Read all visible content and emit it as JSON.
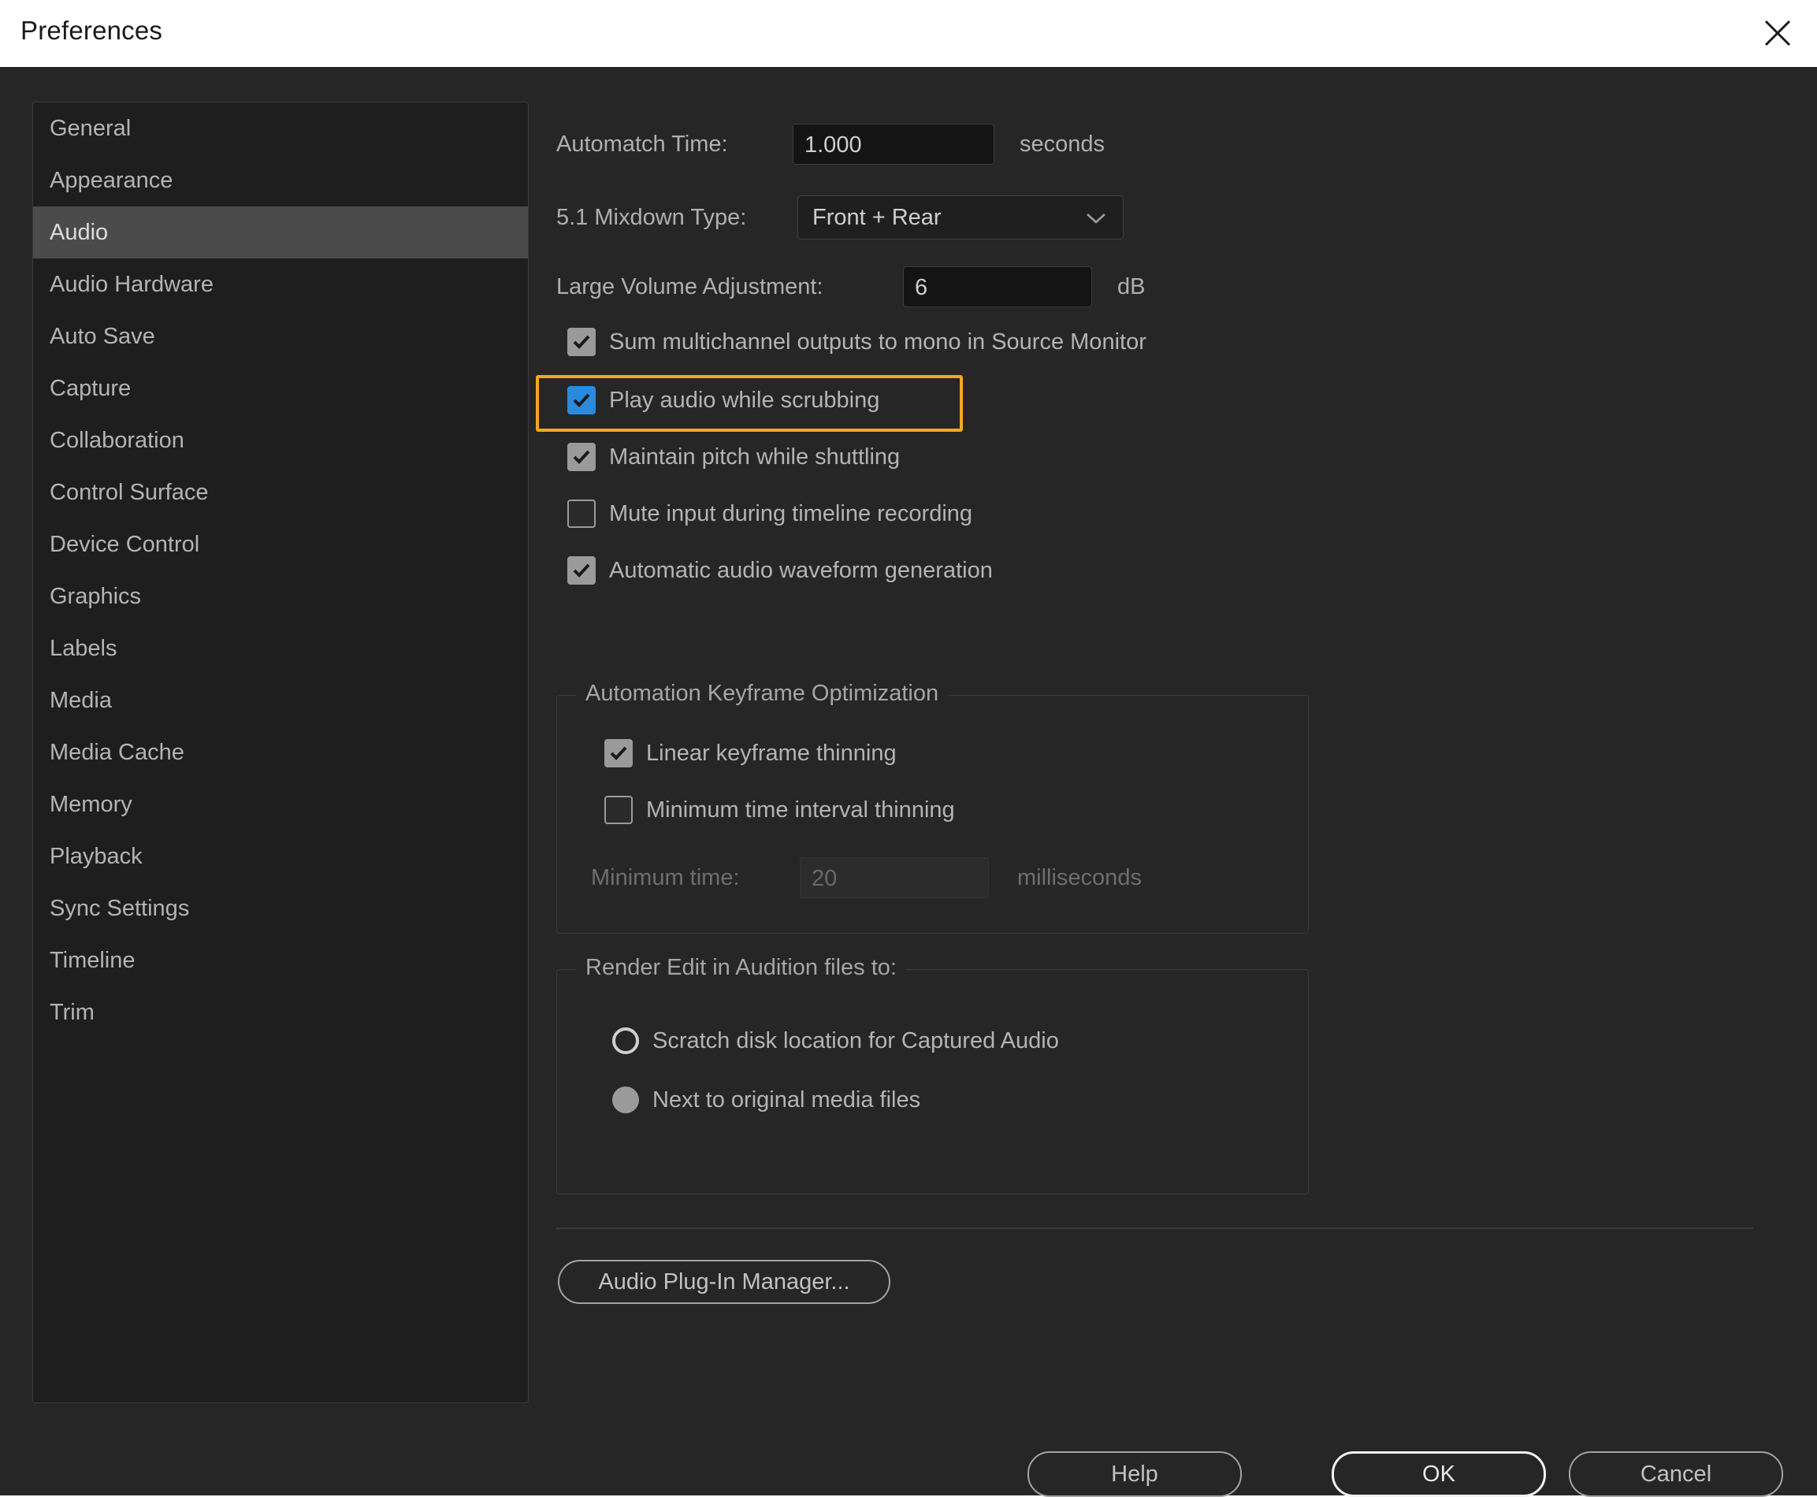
{
  "window": {
    "title": "Preferences",
    "close_icon": "close-icon"
  },
  "colors": {
    "accent_checkbox": "#2a8ae0",
    "focus_highlight": "#f5a623",
    "selected_sidebar": "#4b4b4b",
    "dialog_background": "#262626",
    "sidebar_background": "#1e1e1e",
    "titlebar_background": "#ffffff"
  },
  "sidebar": {
    "items": [
      {
        "label": "General",
        "selected": false
      },
      {
        "label": "Appearance",
        "selected": false
      },
      {
        "label": "Audio",
        "selected": true
      },
      {
        "label": "Audio Hardware",
        "selected": false
      },
      {
        "label": "Auto Save",
        "selected": false
      },
      {
        "label": "Capture",
        "selected": false
      },
      {
        "label": "Collaboration",
        "selected": false
      },
      {
        "label": "Control Surface",
        "selected": false
      },
      {
        "label": "Device Control",
        "selected": false
      },
      {
        "label": "Graphics",
        "selected": false
      },
      {
        "label": "Labels",
        "selected": false
      },
      {
        "label": "Media",
        "selected": false
      },
      {
        "label": "Media Cache",
        "selected": false
      },
      {
        "label": "Memory",
        "selected": false
      },
      {
        "label": "Playback",
        "selected": false
      },
      {
        "label": "Sync Settings",
        "selected": false
      },
      {
        "label": "Timeline",
        "selected": false
      },
      {
        "label": "Trim",
        "selected": false
      }
    ]
  },
  "audio_panel": {
    "automatch_time": {
      "label": "Automatch Time:",
      "value": "1.000",
      "unit": "seconds"
    },
    "mixdown_type": {
      "label": "5.1 Mixdown Type:",
      "value": "Front + Rear",
      "chevron_icon": "chevron-down-icon"
    },
    "large_volume_adjustment": {
      "label": "Large Volume Adjustment:",
      "value": "6",
      "unit": "dB"
    },
    "checkboxes": [
      {
        "label": "Sum multichannel outputs to mono in Source Monitor",
        "checked": true,
        "focused": false,
        "disabled": false
      },
      {
        "label": "Play audio while scrubbing",
        "checked": true,
        "focused": true,
        "disabled": false
      },
      {
        "label": "Maintain pitch while shuttling",
        "checked": true,
        "focused": false,
        "disabled": false
      },
      {
        "label": "Mute input during timeline recording",
        "checked": false,
        "focused": false,
        "disabled": false
      },
      {
        "label": "Automatic audio waveform generation",
        "checked": true,
        "focused": false,
        "disabled": false
      }
    ],
    "keyframe_group": {
      "title": "Automation Keyframe Optimization",
      "checkboxes": [
        {
          "label": "Linear keyframe thinning",
          "checked": true,
          "disabled": false
        },
        {
          "label": "Minimum time interval thinning",
          "checked": false,
          "disabled": false
        }
      ],
      "minimum_time": {
        "label": "Minimum time:",
        "value": "20",
        "unit": "milliseconds",
        "disabled": true
      }
    },
    "render_group": {
      "title": "Render Edit in Audition files to:",
      "options": [
        {
          "label": "Scratch disk location for Captured Audio",
          "selected": false
        },
        {
          "label": "Next to original media files",
          "selected": true
        }
      ]
    },
    "plugin_button": "Audio Plug-In Manager..."
  },
  "footer": {
    "help_label": "Help",
    "ok_label": "OK",
    "cancel_label": "Cancel"
  }
}
